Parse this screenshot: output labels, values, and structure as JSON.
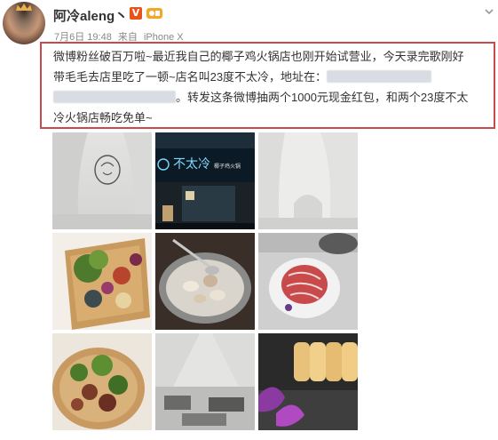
{
  "user": {
    "name": "阿冷aleng丶",
    "vip_badge": "V",
    "post_date": "7月6日 19:48",
    "source_prefix": "来自",
    "source": "iPhone X"
  },
  "post": {
    "line1": "微博粉丝破百万啦~最近我自己的椰子鸡火锅店也刚开始试营业，今天录完歌刚好",
    "line2a": "带毛毛去店里吃了一顿~店名叫23度不太冷，地址在：",
    "line3b": "。转发这条微博抽两个1000元现金红包，和两个23度不太",
    "line4": "冷火锅店畅吃免单~"
  },
  "photos": {
    "shop_sign_text": "不太冷",
    "shop_sign_sub": "椰子鸡火锅"
  },
  "icons": {
    "more": "chevron-down-icon",
    "vip": "vip-v-icon",
    "level": "level-badge-icon"
  },
  "colors": {
    "highlight_border": "#c94a4a",
    "vip_orange": "#e8531a",
    "meta_gray": "#888888"
  }
}
